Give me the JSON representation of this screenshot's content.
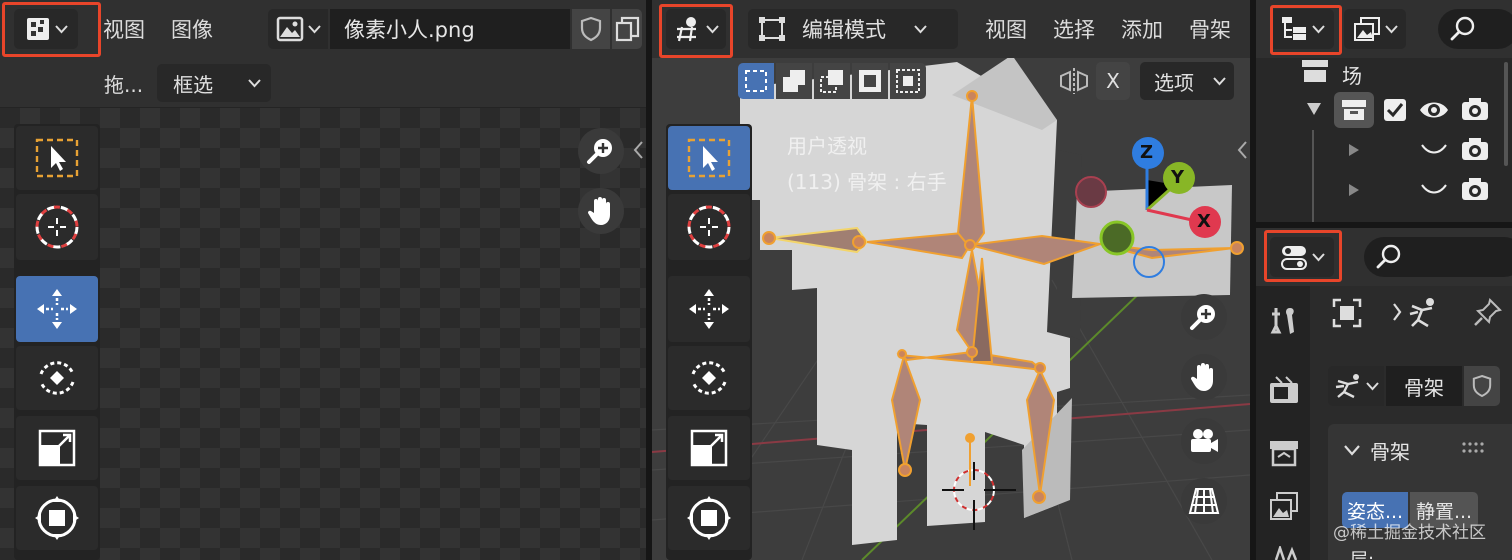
{
  "image_editor": {
    "editor_type_icon": "image-editor-icon",
    "menus": [
      "视图",
      "图像"
    ],
    "image_name": "像素小人.png",
    "drag_label": "拖...",
    "select_mode": "框选"
  },
  "viewport": {
    "editor_type_icon": "3d-viewport-icon",
    "mode": "编辑模式",
    "menus": [
      "视图",
      "选择",
      "添加",
      "骨架"
    ],
    "options": "选项",
    "mirror_axis": "X",
    "overlay_line1": "用户透视",
    "overlay_line2": "(113) 骨架 : 右手",
    "gizmo": {
      "x": "X",
      "y": "Y",
      "z": "Z"
    },
    "colors": {
      "x": "#e0394f",
      "y": "#88b626",
      "z": "#2f7de0",
      "bone": "#f0a030"
    }
  },
  "outliner": {
    "editor_type_icon": "outliner-icon",
    "scene_label": "场景"
  },
  "properties": {
    "editor_type_icon": "properties-icon",
    "object_name": "骨架",
    "panel_title": "骨架",
    "tabs": [
      "姿态...",
      "静置..."
    ],
    "bottom_label": "层:"
  },
  "watermark": "@稀土掘金技术社区",
  "accent": "#4772b3",
  "highlight": "#e8452a"
}
